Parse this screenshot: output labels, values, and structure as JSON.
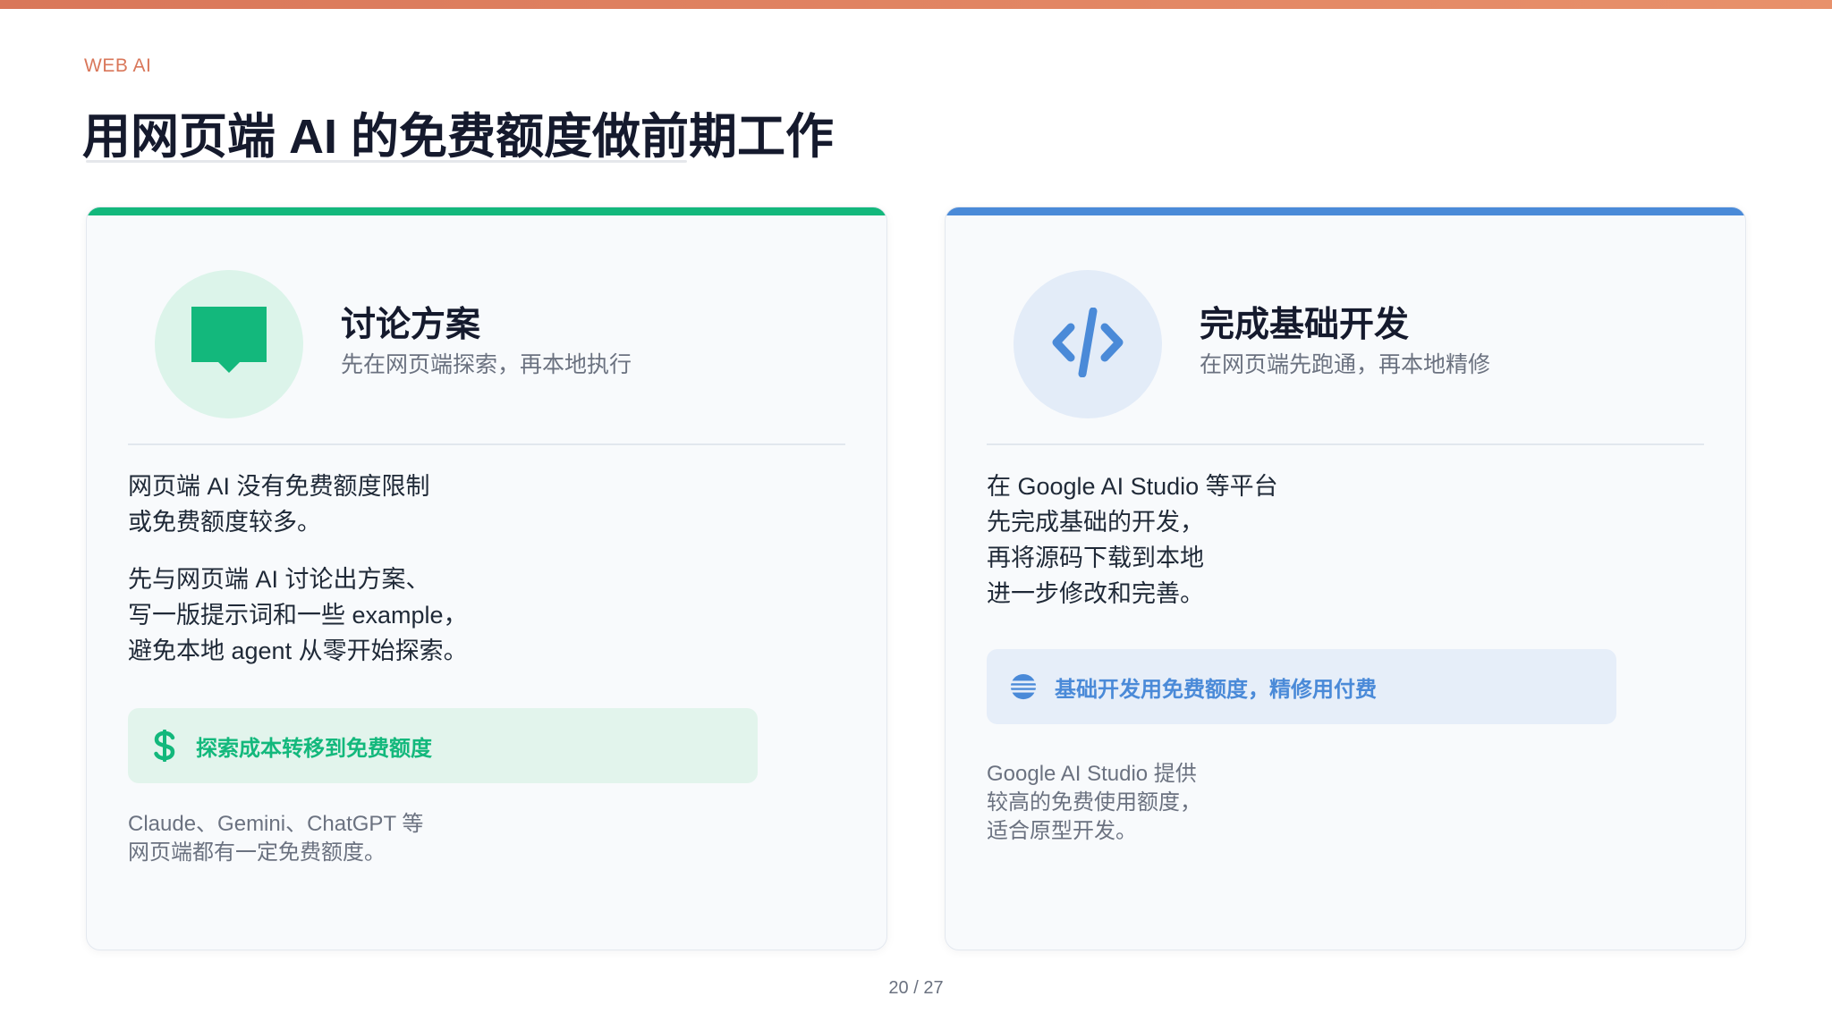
{
  "header": {
    "eyebrow": "WEB AI",
    "title": "用网页端 AI 的免费额度做前期工作"
  },
  "cards": [
    {
      "icon": "chat-bubble-icon",
      "accent_color": "#13b87c",
      "title": "讨论方案",
      "subtitle": "先在网页端探索，再本地执行",
      "paragraphs": [
        [
          "网页端 AI 没有免费额度限制",
          "或免费额度较多。"
        ],
        [
          "先与网页端 AI 讨论出方案、",
          "写一版提示词和一些 example，",
          "避免本地 agent 从零开始探索。"
        ]
      ],
      "callout": {
        "icon": "dollar-icon",
        "text": "探索成本转移到免费额度"
      },
      "note": [
        "Claude、Gemini、ChatGPT 等",
        "网页端都有一定免费额度。"
      ]
    },
    {
      "icon": "code-icon",
      "accent_color": "#4a8ad8",
      "title": "完成基础开发",
      "subtitle": "在网页端先跑通，再本地精修",
      "paragraphs": [
        [
          "在 Google AI Studio 等平台",
          "先完成基础的开发，",
          "再将源码下载到本地",
          "进一步修改和完善。"
        ]
      ],
      "callout": {
        "icon": "layers-icon",
        "text": "基础开发用免费额度，精修用付费"
      },
      "note": [
        "Google AI Studio 提供",
        "较高的免费使用额度，",
        "适合原型开发。"
      ]
    }
  ],
  "footer": {
    "page": "20 / 27"
  }
}
